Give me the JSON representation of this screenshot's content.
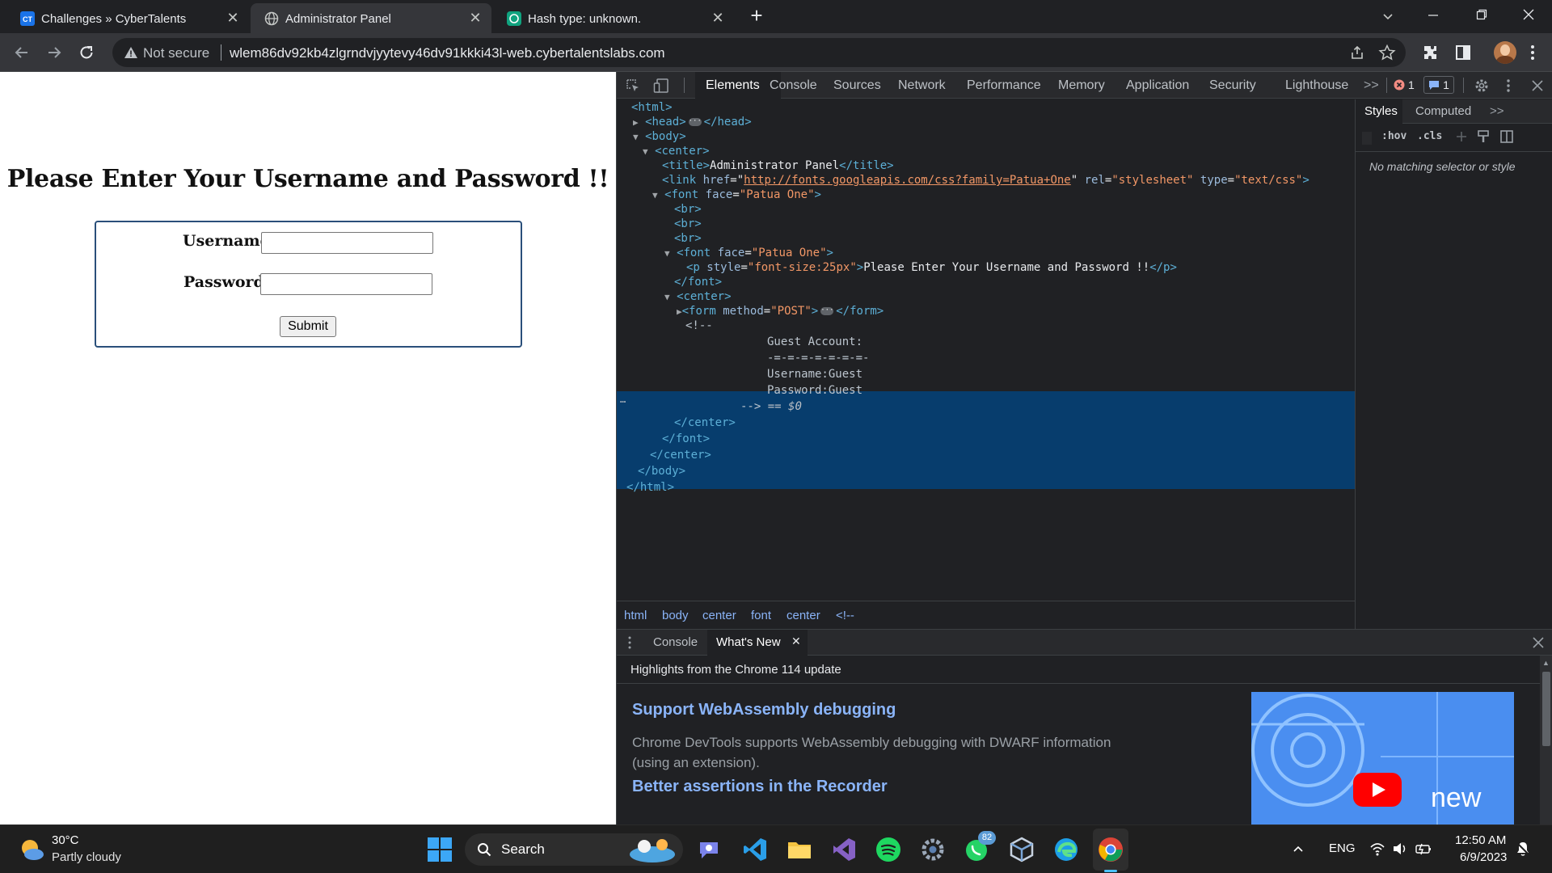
{
  "browser": {
    "tabs": [
      {
        "title": "Challenges » CyberTalents",
        "favicon": "cybertalents-icon",
        "active": false
      },
      {
        "title": "Administrator Panel",
        "favicon": "globe-icon",
        "active": true
      },
      {
        "title": "Hash type: unknown.",
        "favicon": "chatgpt-icon",
        "active": false
      }
    ],
    "security_label": "Not secure",
    "url": "wlem86dv92kb4zlgrndvjyytevy46dv91kkki43l-web.cybertalentslabs.com"
  },
  "page": {
    "heading": "Please Enter Your Username and Password !!",
    "username_label": "Username:",
    "password_label": "Password:",
    "username_value": "",
    "password_value": "",
    "submit_label": "Submit"
  },
  "devtools": {
    "tabs": [
      "Elements",
      "Console",
      "Sources",
      "Network",
      "Performance",
      "Memory",
      "Application",
      "Security",
      "Lighthouse"
    ],
    "more_tabs": ">>",
    "errors_count": "1",
    "messages_count": "1",
    "dom": {
      "html_open": "<html>",
      "head": "<head>",
      "head_close": "</head>",
      "body_open": "<body>",
      "center_open": "<center>",
      "title_open": "<title>",
      "title_text": "Administrator Panel",
      "title_close": "</title>",
      "link_open": "<link ",
      "link_href_attr": "href",
      "link_href": "http://fonts.googleapis.com/css?family=Patua+One",
      "link_rel_attr": "rel",
      "link_rel": "\"stylesheet\"",
      "link_type_attr": "type",
      "link_type": "\"text/css\"",
      "font_open": "<font ",
      "font_face_attr": "face",
      "font_face": "\"Patua One\"",
      "br": "<br>",
      "p_open": "<p ",
      "p_style_attr": "style",
      "p_style": "\"font-size:25px\"",
      "p_text": "Please Enter Your Username and Password !!",
      "p_close": "</p>",
      "font_close": "</font>",
      "form_open": "<form ",
      "form_method_attr": "method",
      "form_method": "\"POST\"",
      "form_close": "</form>",
      "comment_open": "<!--",
      "comment_lines": [
        "Guest Account:",
        "-=-=-=-=-=-=-=-",
        "Username:Guest",
        "Password:Guest"
      ],
      "comment_close": "-->",
      "selected_marker": "== $0",
      "center_close": "</center>",
      "body_close": "</body>",
      "html_close": "</html>"
    },
    "breadcrumbs": [
      "html",
      "body",
      "center",
      "font",
      "center",
      "<!--"
    ],
    "styles": {
      "tabs": [
        "Styles",
        "Computed"
      ],
      "hov": ":hov",
      "cls": ".cls",
      "empty": "No matching selector or style"
    },
    "drawer": {
      "tabs": [
        "Console",
        "What's New"
      ],
      "highlights": "Highlights from the Chrome 114 update",
      "article1_title": "Support WebAssembly debugging",
      "article1_body": "Chrome DevTools supports WebAssembly debugging with DWARF information (using an extension).",
      "article2_title": "Better assertions in the Recorder",
      "video_label": "new"
    }
  },
  "taskbar": {
    "weather_temp": "30°C",
    "weather_desc": "Partly cloudy",
    "search_label": "Search",
    "whatsapp_badge": "82",
    "language": "ENG",
    "time": "12:50 AM",
    "date": "6/9/2023"
  },
  "colors": {
    "accent": "#8ab4f8",
    "selection": "#073d6d",
    "error_badge": "#f28b82"
  }
}
